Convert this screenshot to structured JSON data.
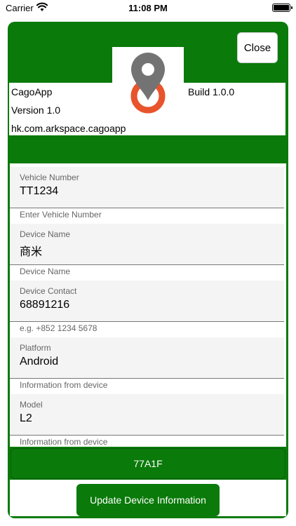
{
  "status_bar": {
    "carrier": "Carrier",
    "time": "11:08 PM",
    "icons": [
      "wifi-icon",
      "battery-icon"
    ]
  },
  "header": {
    "close_label": "Close",
    "logo_icon": "location-pin-icon",
    "logo_colors": {
      "pin": "#737373",
      "ring": "#e8542b"
    }
  },
  "app_info": {
    "name": "CagoApp",
    "version": "Version 1.0",
    "bundle_id": "hk.com.arkspace.cagoapp",
    "build": "Build 1.0.0"
  },
  "fields": [
    {
      "label": "Vehicle Number",
      "value": "TT1234",
      "hint": "Enter Vehicle Number"
    },
    {
      "label": "Device Name",
      "value": "商米",
      "hint": "Device Name"
    },
    {
      "label": "Device Contact",
      "value": "68891216",
      "hint": "e.g. +852 1234 5678"
    },
    {
      "label": "Platform",
      "value": "Android",
      "hint": "Information from device"
    },
    {
      "label": "Model",
      "value": "L2",
      "hint": "Information from device"
    }
  ],
  "device_id": "77A1F",
  "update_button_label": "Update Device Information",
  "colors": {
    "accent": "#0a7a0a"
  }
}
